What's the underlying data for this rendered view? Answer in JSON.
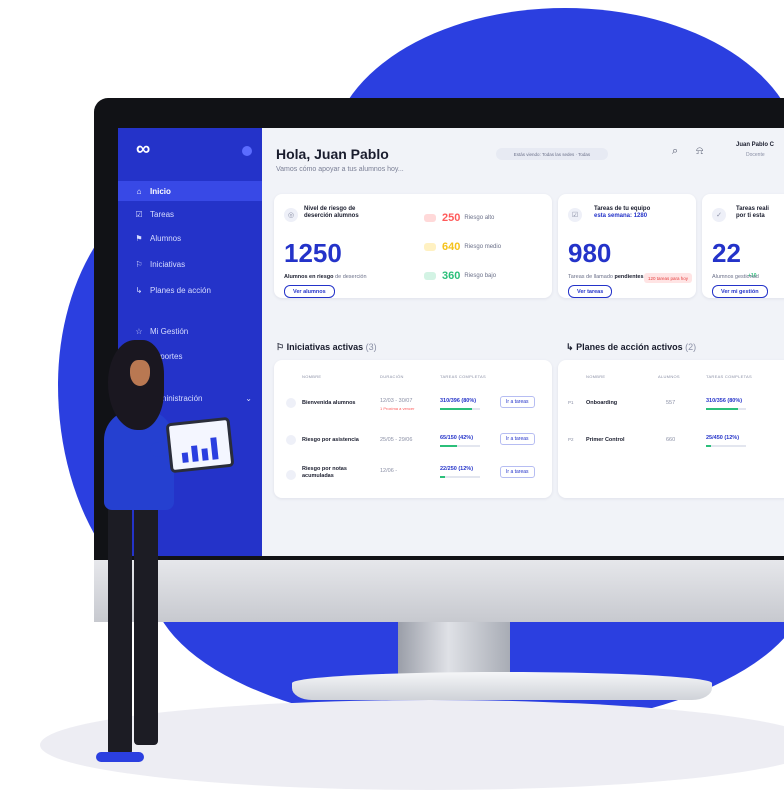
{
  "sidebar": {
    "items": [
      {
        "icon": "home-icon",
        "label": "Inicio",
        "active": true
      },
      {
        "icon": "tasks-icon",
        "label": "Tareas"
      },
      {
        "icon": "students-icon",
        "label": "Alumnos"
      },
      {
        "icon": "flag-icon",
        "label": "Iniciativas"
      },
      {
        "icon": "action-plan-icon",
        "label": "Planes de acción"
      },
      {
        "icon": "star-icon",
        "label": "Mi Gestión"
      },
      {
        "icon": "chart-icon",
        "label": "Reportes"
      },
      {
        "icon": "settings-icon",
        "label": "Administración"
      }
    ]
  },
  "header": {
    "greeting": "Hola, Juan Pablo",
    "subtitle": "Vamos cómo apoyar a tus alumnos hoy...",
    "filter_pill": "Estás viendo: Todas las sedes · Todas",
    "user_name": "Juan Pablo C",
    "user_role": "Docente"
  },
  "kpi_risk": {
    "title_line1": "Nivel de riesgo de",
    "title_line2": "deserción alumnos",
    "value": "1250",
    "caption_prefix": "Alumnos en riesgo",
    "caption_suffix": " de deserción",
    "button": "Ver alumnos",
    "levels": [
      {
        "value": "250",
        "label": "Riesgo alto",
        "color": "#ff6b6b"
      },
      {
        "value": "640",
        "label": "Riesgo medio",
        "color": "#ffd34d"
      },
      {
        "value": "360",
        "label": "Riesgo bajo",
        "color": "#36c98a"
      }
    ]
  },
  "kpi_tasks": {
    "title_line1": "Tareas de tu equipo",
    "title_line2": "esta semana: 1280",
    "value": "980",
    "badge": "120 tareas para hoy",
    "caption_prefix": "Tareas de llamado ",
    "caption_bold": "pendientes",
    "button": "Ver tareas"
  },
  "kpi_mine": {
    "title_line1": "Tareas reali",
    "title_line2": "por ti esta",
    "value": "22",
    "delta": "+10",
    "caption": "Alumnos gestionad",
    "button": "Ver mi gestión"
  },
  "initiatives": {
    "title": "Iniciativas activas",
    "count": "(3)",
    "columns": [
      "NOMBRE",
      "DURACIÓN",
      "TAREAS COMPLETAS"
    ],
    "rows": [
      {
        "name": "Bienvenida alumnos",
        "duration": "12/03 - 30/07",
        "duration_note": "1 Proxima a vencer",
        "tasks": "310/396 (80%)",
        "progress": 0.8,
        "action": "Ir a tareas"
      },
      {
        "name": "Riesgo por asistencia",
        "duration": "25/05 - 29/06",
        "duration_note": "",
        "tasks": "65/150 (42%)",
        "progress": 0.42,
        "action": "Ir a tareas"
      },
      {
        "name": "Riesgo por notas acumuladas",
        "duration": "12/06 -",
        "duration_note": "",
        "tasks": "22/250 (12%)",
        "progress": 0.12,
        "action": "Ir a tareas"
      }
    ]
  },
  "plans": {
    "title": "Planes de acción activos",
    "count": "(2)",
    "columns": [
      "NOMBRE",
      "ALUMNOS",
      "TAREAS COMPLETAS"
    ],
    "rows": [
      {
        "tag": "P1",
        "name": "Onboarding",
        "students": "557",
        "tasks": "310/356 (80%)",
        "progress": 0.8
      },
      {
        "tag": "P2",
        "name": "Primer Control",
        "students": "660",
        "tasks": "25/450 (12%)",
        "progress": 0.12
      }
    ]
  },
  "colors": {
    "brand": "#2433c9",
    "accent": "#2b3fe0",
    "success": "#2bbf7a"
  }
}
